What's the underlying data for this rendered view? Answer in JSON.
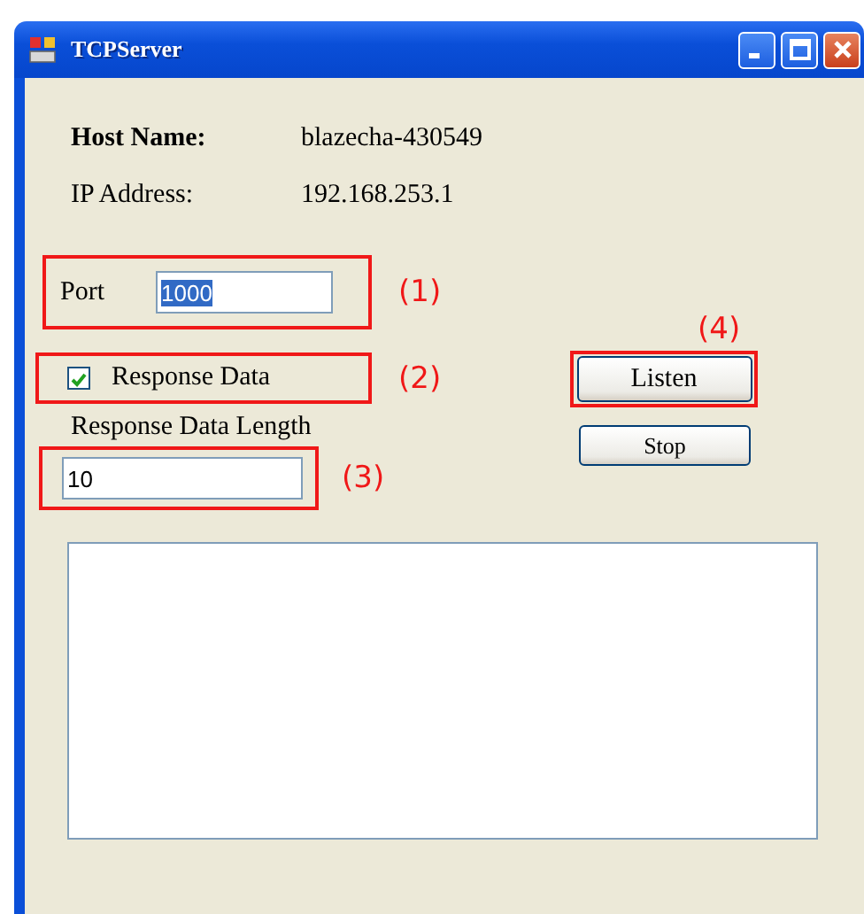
{
  "window": {
    "title": "TCPServer"
  },
  "host_name": {
    "label": "Host Name:",
    "value": "blazecha-430549"
  },
  "ip_address": {
    "label": "IP Address:",
    "value": "192.168.253.1"
  },
  "port": {
    "label": "Port",
    "value": "1000",
    "text_selected": true
  },
  "response_data": {
    "label": "Response Data",
    "checked": true
  },
  "response_data_length": {
    "label": "Response Data Length",
    "value": "10"
  },
  "buttons": [
    {
      "label": "Listen",
      "kind": "primary"
    },
    {
      "label": "Stop",
      "kind": "small"
    }
  ],
  "annotations": [
    "(1)",
    "(2)",
    "(3)",
    "(4)"
  ]
}
